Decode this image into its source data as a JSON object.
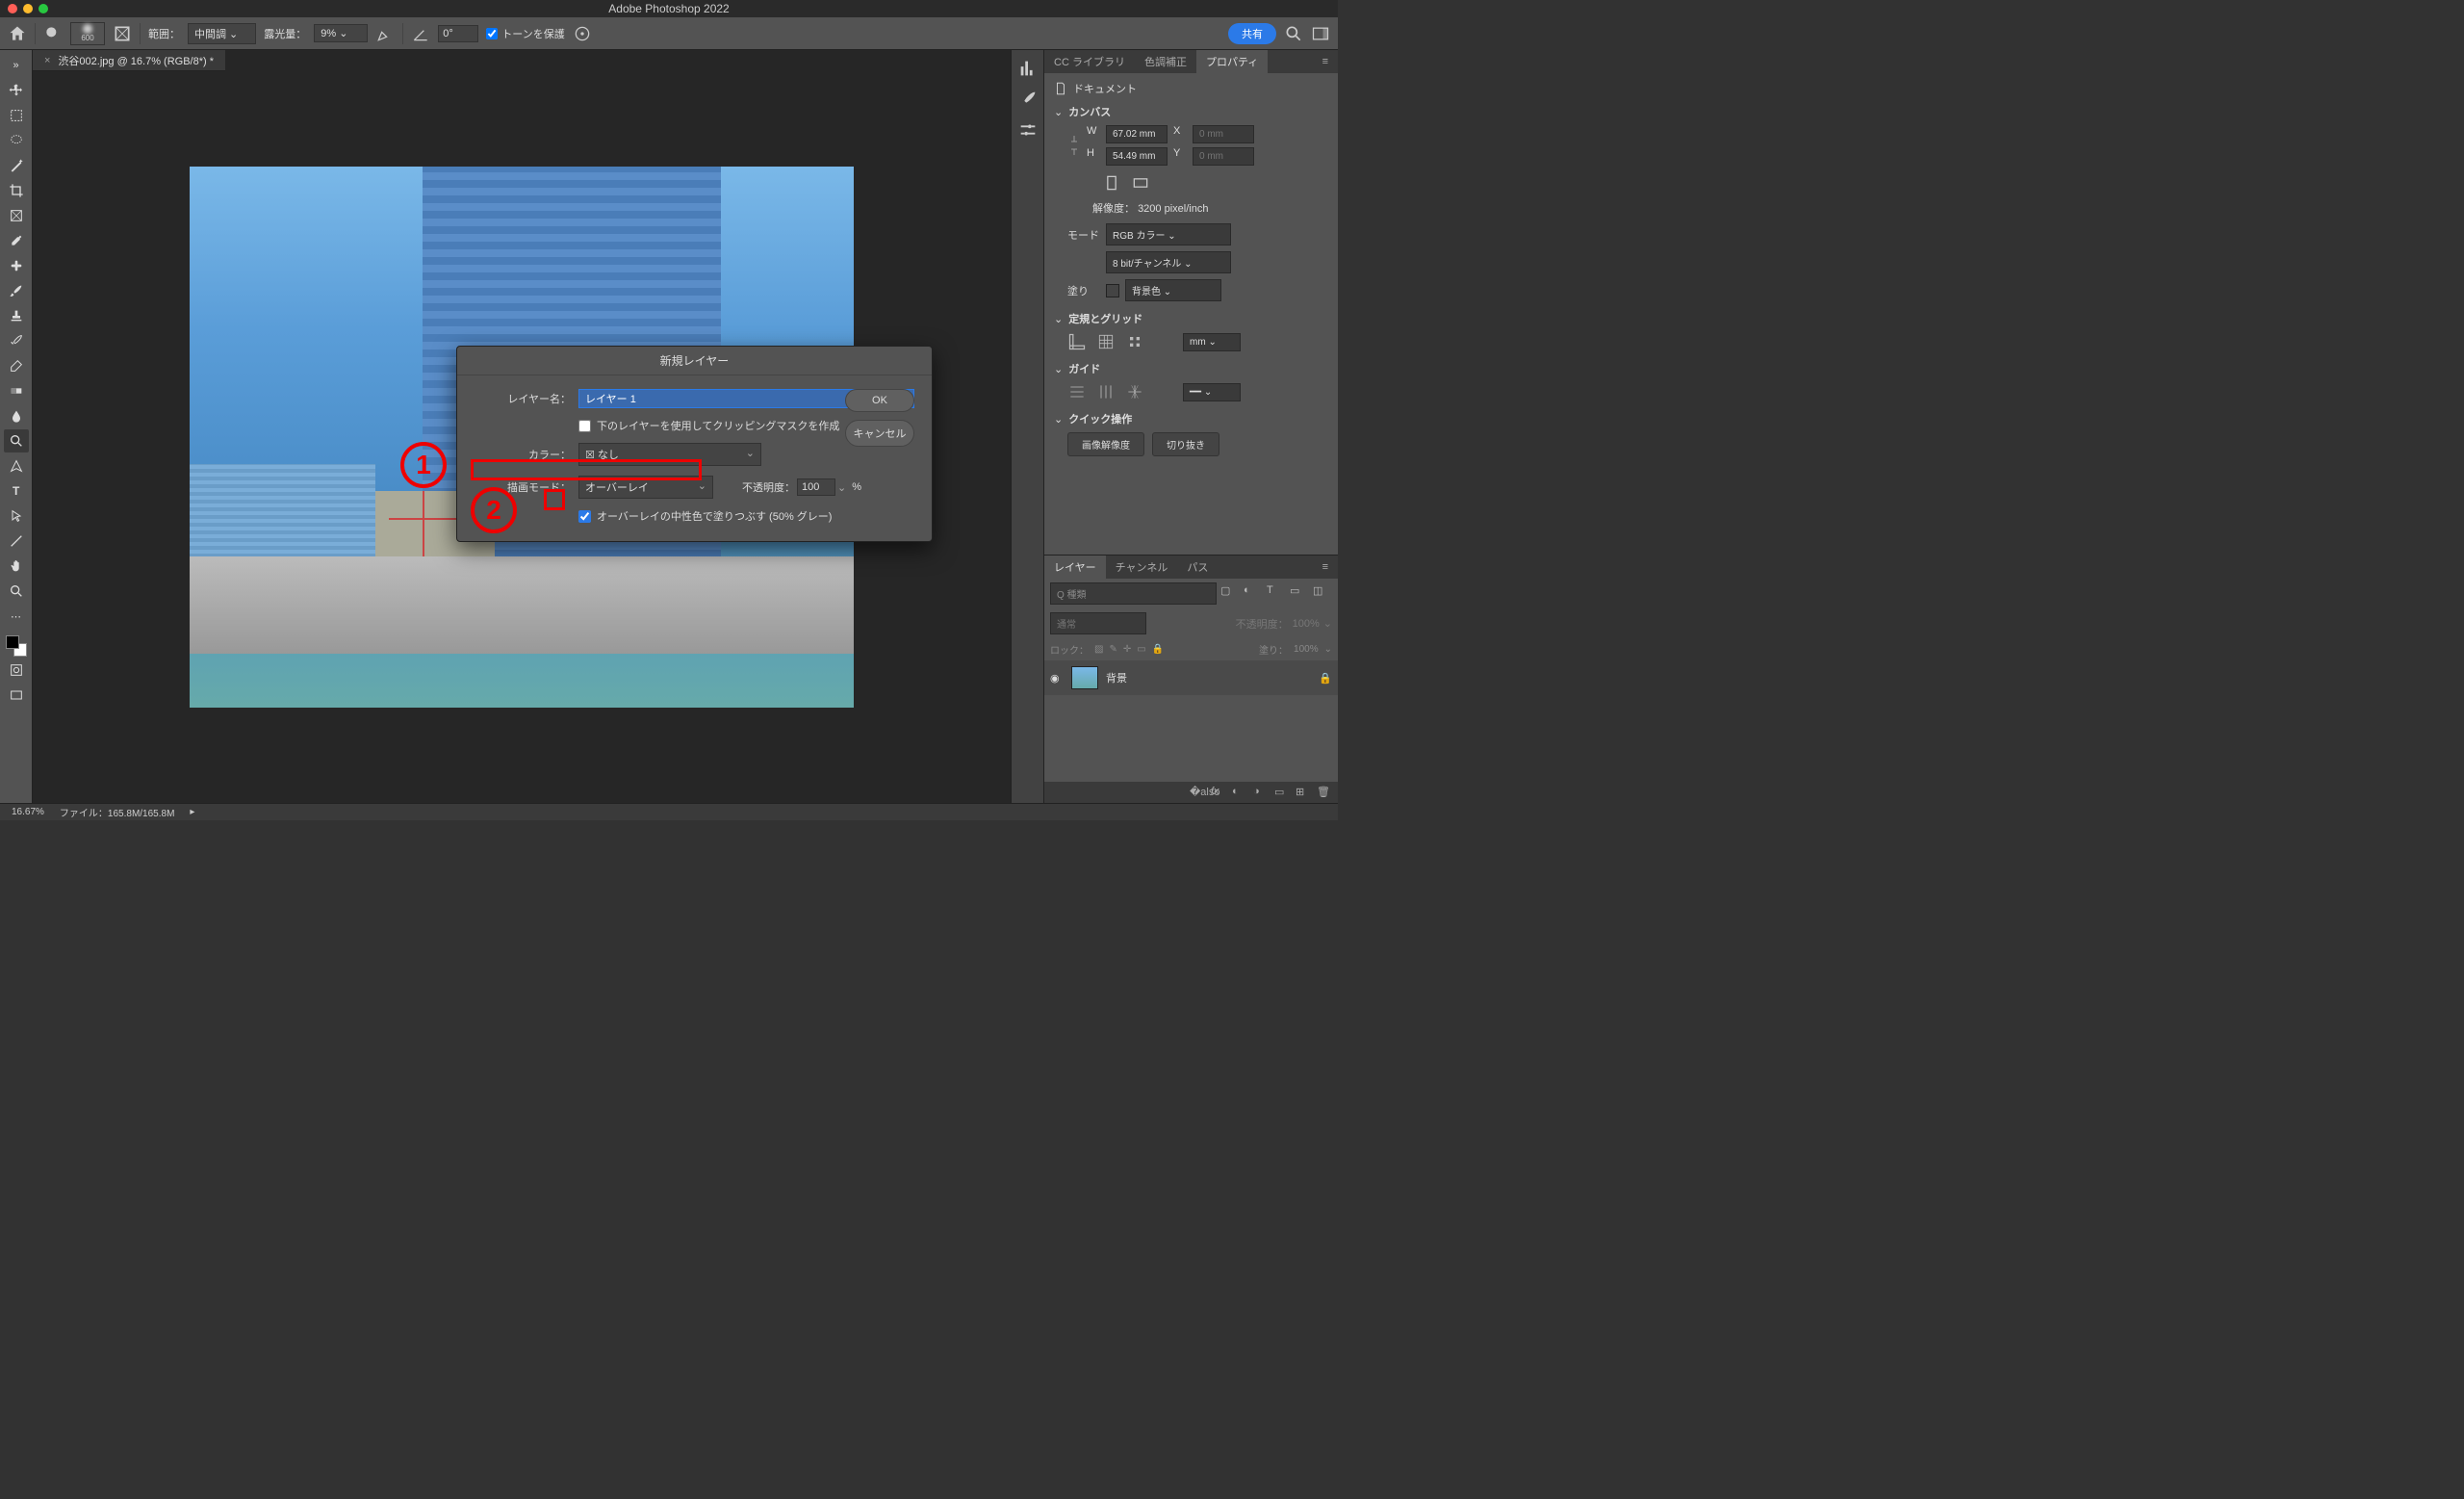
{
  "app_title": "Adobe Photoshop 2022",
  "options_bar": {
    "brush_size": "600",
    "range_label": "範囲：",
    "range_value": "中間調",
    "exposure_label": "露光量：",
    "exposure_value": "9%",
    "angle": "0°",
    "protect_tone": "トーンを保護",
    "share": "共有"
  },
  "doc_tab": "渋谷002.jpg @ 16.7% (RGB/8*) *",
  "dialog": {
    "title": "新規レイヤー",
    "layer_name_label": "レイヤー名：",
    "layer_name_value": "レイヤー 1",
    "clip_mask": "下のレイヤーを使用してクリッピングマスクを作成",
    "color_label": "カラー：",
    "color_value": "なし",
    "mode_label": "描画モード：",
    "mode_value": "オーバーレイ",
    "opacity_label": "不透明度：",
    "opacity_value": "100",
    "opacity_unit": "%",
    "fill_neutral": "オーバーレイの中性色で塗りつぶす (50% グレー)",
    "ok": "OK",
    "cancel": "キャンセル",
    "annotation_1": "1",
    "annotation_2": "2"
  },
  "panels": {
    "tabs": {
      "cc_lib": "CC ライブラリ",
      "color_adj": "色調補正",
      "properties": "プロパティ"
    },
    "doc_label": "ドキュメント",
    "canvas": {
      "title": "カンバス",
      "w": "67.02 mm",
      "h": "54.49 mm",
      "x_placeholder": "0 mm",
      "y_placeholder": "0 mm",
      "resolution_label": "解像度：",
      "resolution_value": "3200 pixel/inch",
      "mode_label": "モード",
      "mode_value": "RGB カラー",
      "bit_value": "8 bit/チャンネル",
      "fill_label": "塗り",
      "fill_value": "背景色"
    },
    "rulers": {
      "title": "定規とグリッド",
      "unit": "mm"
    },
    "guides": {
      "title": "ガイド"
    },
    "quick": {
      "title": "クイック操作",
      "resolution": "画像解像度",
      "crop": "切り抜き"
    }
  },
  "layers": {
    "tabs": {
      "layers": "レイヤー",
      "channels": "チャンネル",
      "paths": "パス"
    },
    "filter_placeholder": "Q 種類",
    "blend": "通常",
    "opacity_label": "不透明度：",
    "opacity_value": "100%",
    "lock_label": "ロック：",
    "fill_label": "塗り：",
    "fill_value": "100%",
    "bg_layer": "背景"
  },
  "status": {
    "zoom": "16.67%",
    "file_label": "ファイル：",
    "file_value": "165.8M/165.8M"
  }
}
